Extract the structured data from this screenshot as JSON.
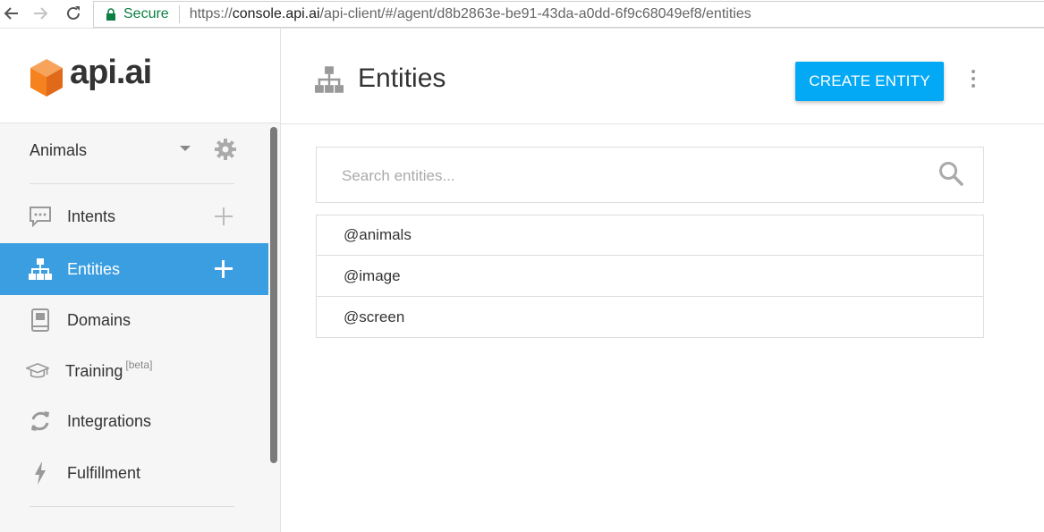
{
  "browser": {
    "secure_label": "Secure",
    "url_scheme": "https://",
    "url_host": "console.api.ai",
    "url_path": "/api-client/#/agent/d8b2863e-be91-43da-a0dd-6f9c68049ef8/entities"
  },
  "brand": {
    "logo_text": "api.ai",
    "logo_color": "#f5821f"
  },
  "sidebar": {
    "agent_name": "Animals",
    "items": [
      {
        "label": "Intents",
        "icon": "chat-bubble-icon",
        "has_add": true,
        "active": false
      },
      {
        "label": "Entities",
        "icon": "sitemap-icon",
        "has_add": true,
        "active": true
      },
      {
        "label": "Domains",
        "icon": "book-icon",
        "has_add": false,
        "active": false
      },
      {
        "label": "Training",
        "badge": "[beta]",
        "icon": "graduation-cap-icon",
        "has_add": false,
        "active": false
      },
      {
        "label": "Integrations",
        "icon": "sync-icon",
        "has_add": false,
        "active": false
      },
      {
        "label": "Fulfillment",
        "icon": "lightning-icon",
        "has_add": false,
        "active": false
      }
    ]
  },
  "main": {
    "title": "Entities",
    "create_button": "CREATE ENTITY",
    "search_placeholder": "Search entities...",
    "entities": [
      "@animals",
      "@image",
      "@screen"
    ]
  },
  "colors": {
    "accent": "#03a9f4",
    "active_nav": "#3b9ee0",
    "secure": "#0b8043"
  }
}
